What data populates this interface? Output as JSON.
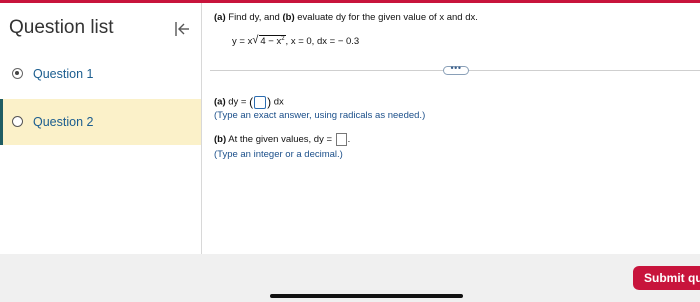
{
  "sidebar": {
    "title": "Question list",
    "items": [
      {
        "label": "Question 1",
        "state": "answered"
      },
      {
        "label": "Question 2",
        "state": "current"
      }
    ]
  },
  "question": {
    "prompt_a_bold": "(a)",
    "prompt_a_text": " Find dy, and ",
    "prompt_b_bold": "(b)",
    "prompt_b_text": " evaluate dy for the given value of x and dx.",
    "equation_lhs": "y = x",
    "equation_radicand": "4 − x",
    "equation_exponent": "2",
    "equation_rest": ", x = 0, dx = − 0.3",
    "more_label": "•••",
    "part_a_label": "(a)",
    "part_a_prefix": " dy = ",
    "part_a_suffix": " dx",
    "part_a_hint": "(Type an exact answer, using radicals as needed.)",
    "part_b_label": "(b)",
    "part_b_prefix": " At the given values, dy = ",
    "part_b_suffix": ".",
    "part_b_hint": "(Type an integer or a decimal.)"
  },
  "footer": {
    "submit_label": "Submit qu"
  },
  "colors": {
    "accent": "#c8143c",
    "active_bg": "#fbf1c9",
    "active_bar": "#1f5d63",
    "link": "#1b5d8f"
  }
}
